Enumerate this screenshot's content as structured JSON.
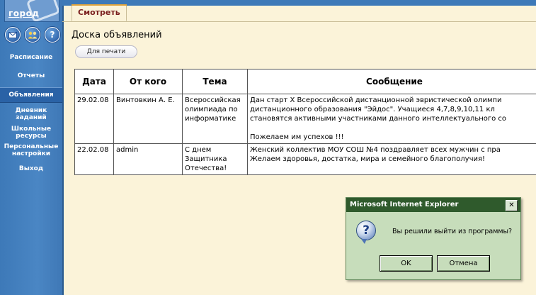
{
  "sidebar": {
    "logo_text": "город",
    "icons": [
      "envelope-icon",
      "people-icon",
      "help-icon"
    ],
    "help_glyph": "?",
    "items": [
      {
        "label": "Расписание"
      },
      {
        "label": "Отчеты"
      },
      {
        "label": "Объявления"
      },
      {
        "label_l1": "Дневник",
        "label_l2": "заданий"
      },
      {
        "label_l1": "Школьные",
        "label_l2": "ресурсы"
      },
      {
        "label_l1": "Персональные",
        "label_l2": "настройки"
      },
      {
        "label": "Выход"
      }
    ]
  },
  "tabs": {
    "view": "Смотреть"
  },
  "main": {
    "title": "Доска объявлений",
    "print_button": "Для печати",
    "table": {
      "headers": [
        "Дата",
        "От кого",
        "Тема",
        "Сообщение"
      ],
      "rows": [
        {
          "date": "29.02.08",
          "from": "Винтовкин А. Е.",
          "topic_l1": "Всероссийская",
          "topic_l2": "олимпиада по",
          "topic_l3": "информатике",
          "msg_l1": "Дан старт X Всероссийской дистанционной эвристической олимпи",
          "msg_l2": "дистанционного образования \"Эйдос\". Учащиеся 4,7,8,9,10,11 кл",
          "msg_l3": "становятся активными участниками данного интеллектуального со",
          "msg_l4": "Пожелаем им успехов !!!"
        },
        {
          "date": "22.02.08",
          "from": "admin",
          "topic_l1": "С днем",
          "topic_l2": "Защитника",
          "topic_l3": "Отечества!",
          "msg_l1": "Женский коллектив МОУ СОШ №4 поздравляет всех мужчин с пра",
          "msg_l2": "Желаем здоровья, достатка, мира и семейного благополучия!"
        }
      ]
    }
  },
  "dialog": {
    "title": "Microsoft Internet Explorer",
    "close_glyph": "✕",
    "icon_glyph": "?",
    "message": "Вы решили выйти из программы?",
    "ok": "OK",
    "cancel": "Отмена"
  }
}
